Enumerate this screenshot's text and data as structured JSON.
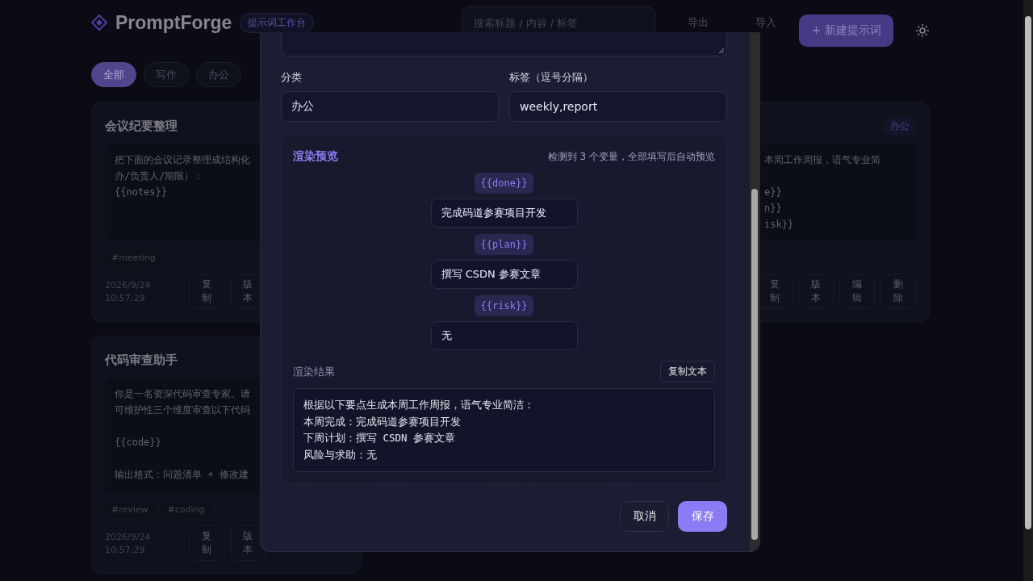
{
  "app": {
    "logo": "PromptForge",
    "badge": "提示词工作台"
  },
  "search": {
    "placeholder": "搜索标题 / 内容 / 标签"
  },
  "header_actions": [
    "导出",
    "导入"
  ],
  "new_button": "+ 新建提示词",
  "filters": [
    {
      "label": "全部",
      "selected": true
    },
    {
      "label": "写作",
      "selected": false
    },
    {
      "label": "办公",
      "selected": false
    }
  ],
  "cards": [
    {
      "title": "会议纪要整理",
      "paragraphs": [
        [
          "把下面的会议记录整理成结构化",
          "办/负责人/期限）：",
          "{{notes}}"
        ]
      ],
      "tags": [
        "#meeting"
      ],
      "date": "2026/9/24",
      "time": "10:57:29",
      "actions": [
        "复制",
        "版本"
      ]
    },
    {
      "category": "办公",
      "paragraphs": [
        [
          "本周工作周报，语气专业简"
        ],
        [
          "e}}",
          "n}}",
          "isk}}"
        ]
      ],
      "actions": [
        "复制",
        "版本",
        "编辑",
        "删除"
      ]
    },
    {
      "title": "代码审查助手",
      "paragraphs": [
        [
          "你是一名资深代码审查专家。请",
          "可维护性三个维度审查以下代码"
        ],
        [
          "{{code}}"
        ],
        [
          "输出格式：问题清单 + 修改建"
        ]
      ],
      "tags": [
        "#review",
        "#coding"
      ],
      "date": "2026/9/24",
      "time": "10:57:29",
      "actions": [
        "复制",
        "版本"
      ]
    }
  ],
  "editor": {
    "category_label": "分类",
    "category_value": "办公",
    "tags_label": "标签（逗号分隔）",
    "tags_value": "weekly,report",
    "preview": {
      "title": "渲染预览",
      "hint": "检测到 3 个变量，全部填写后自动预览",
      "variables": [
        {
          "name": "{{done}}",
          "value": "完成码道参赛项目开发"
        },
        {
          "name": "{{plan}}",
          "value": "撰写 CSDN 参赛文章"
        },
        {
          "name": "{{risk}}",
          "value": "无"
        }
      ],
      "result_label": "渲染结果",
      "copy_button": "复制文本",
      "result": [
        "根据以下要点生成本周工作周报，语气专业简洁：",
        "本周完成：完成码道参赛项目开发",
        "下周计划：撰写 CSDN 参赛文章",
        "风险与求助：无"
      ]
    },
    "cancel": "取消",
    "save": "保存"
  }
}
